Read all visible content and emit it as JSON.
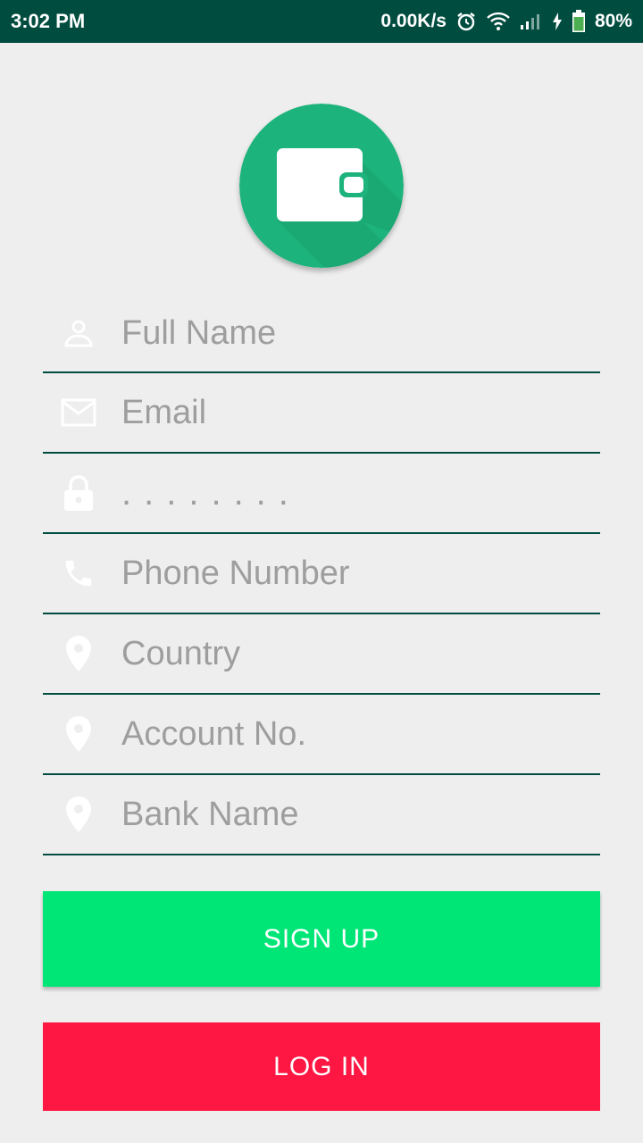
{
  "status_bar": {
    "time": "3:02 PM",
    "network_speed": "0.00K/s",
    "battery": "80%",
    "icons": [
      "alarm-icon",
      "wifi-icon",
      "signal-icon",
      "charging-icon",
      "battery-icon"
    ]
  },
  "logo": {
    "icon": "wallet-icon",
    "color": "#1db37d"
  },
  "form": {
    "full_name_placeholder": "Full Name",
    "email_placeholder": "Email",
    "password_value": "........",
    "phone_placeholder": "Phone Number",
    "country_placeholder": "Country",
    "account_placeholder": "Account No.",
    "bank_placeholder": "Bank Name"
  },
  "buttons": {
    "signup_label": "SIGN UP",
    "login_label": "LOG IN"
  },
  "colors": {
    "status_bar": "#004d40",
    "underline": "#004d40",
    "signup": "#00e676",
    "login": "#ff1744"
  }
}
